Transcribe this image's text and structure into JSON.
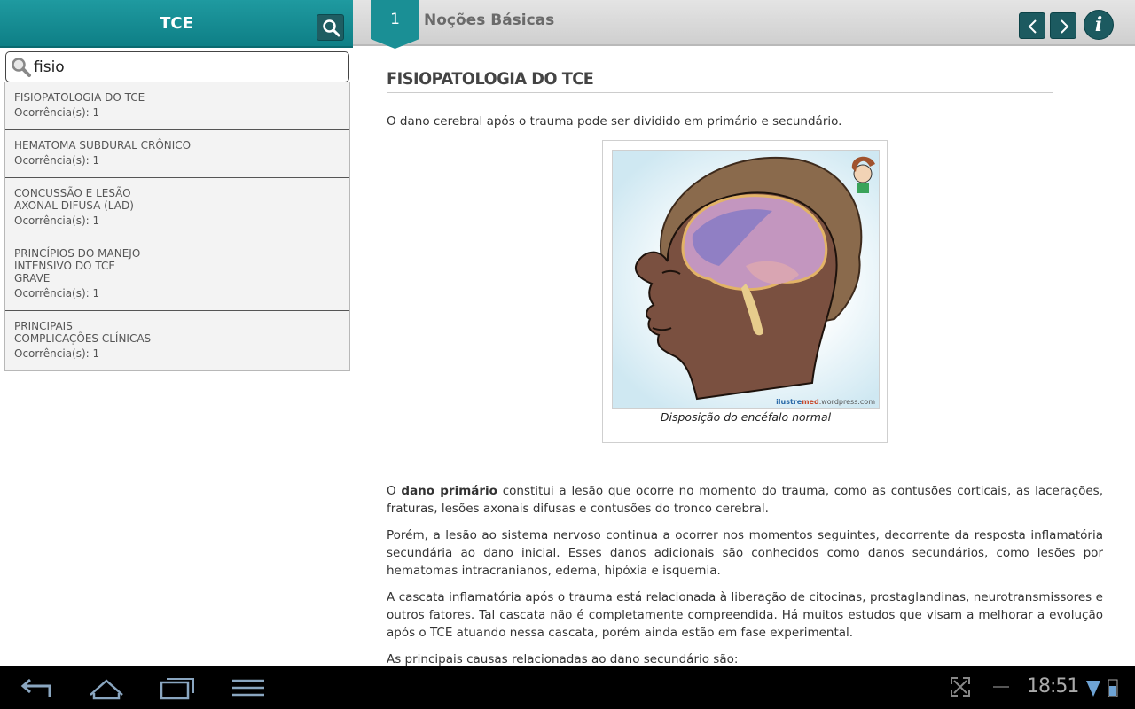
{
  "sidebar": {
    "title": "TCE",
    "search_value": "fisio",
    "results": [
      {
        "title": "FISIOPATOLOGIA DO TCE",
        "count": "Ocorrência(s): 1"
      },
      {
        "title": "HEMATOMA SUBDURAL CRÔNICO",
        "count": "Ocorrência(s): 1"
      },
      {
        "title": "CONCUSSÃO E LESÃO AXONAL DIFUSA (LAD)",
        "count": "Ocorrência(s): 1"
      },
      {
        "title": "PRINCÍPIOS DO MANEJO INTENSIVO DO TCE GRAVE",
        "count": "Ocorrência(s): 1"
      },
      {
        "title": "PRINCIPAIS COMPLICAÇÕES CLÍNICAS",
        "count": "Ocorrência(s): 1"
      }
    ]
  },
  "header": {
    "chapter_number": "1",
    "chapter_title": "Noções Básicas"
  },
  "article": {
    "title": "FISIOPATOLOGIA DO TCE",
    "intro": "O dano cerebral após o trauma pode ser dividido em primário e secundário.",
    "figure_caption": "Disposição do encéfalo normal",
    "watermark_a": "ilustre",
    "watermark_b": "med",
    "watermark_c": ".wordpress.com",
    "p1_prefix": "O ",
    "p1_bold": "dano primário",
    "p1_rest": " constitui a lesão que ocorre no momento do trauma, como as contusões corticais, as lacerações, fraturas, lesões axonais difusas e contusões do tronco cerebral.",
    "p2": "Porém, a lesão ao sistema nervoso continua a ocorrer nos momentos seguintes, decorrente da resposta inflamatória secundária ao dano inicial. Esses danos adicionais são conhecidos como danos secundários, como lesões por hematomas intracranianos, edema, hipóxia e isquemia.",
    "p3": "A cascata inflamatória após o trauma está relacionada à liberação de citocinas, prostaglandinas, neurotransmissores e outros fatores. Tal cascata não é completamente compreendida. Há muitos estudos que visam a melhorar a evolução após o TCE atuando nessa cascata, porém ainda estão em fase experimental.",
    "p4": "As principais causas relacionadas ao dano secundário são:"
  },
  "system": {
    "clock": "18:51"
  },
  "colors": {
    "teal": "#1a8f95",
    "dark_teal_button": "#1c5a60"
  }
}
